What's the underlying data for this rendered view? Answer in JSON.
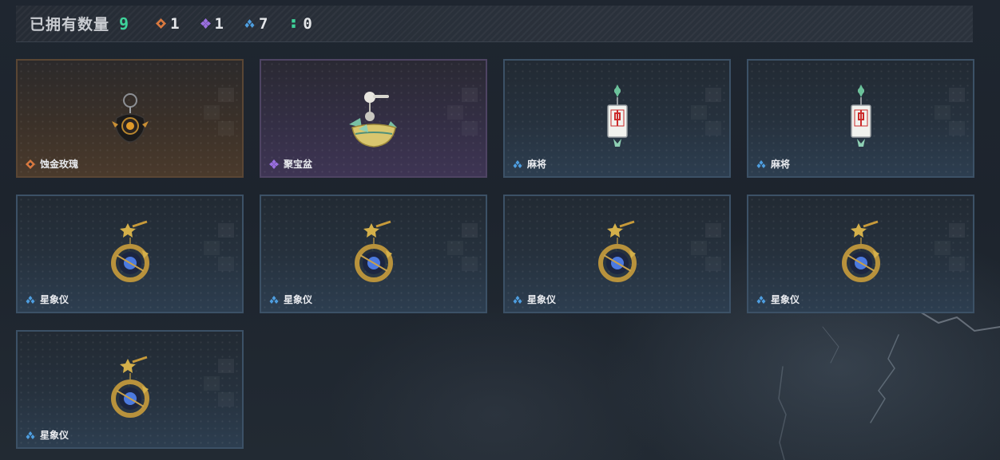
{
  "header": {
    "title": "已拥有数量",
    "total": "9",
    "counts": [
      {
        "rarity": "orange",
        "icon": "orange-gem-icon",
        "color": "#d9793f",
        "value": "1"
      },
      {
        "rarity": "purple",
        "icon": "purple-gem-icon",
        "color": "#9a6fe0",
        "value": "1"
      },
      {
        "rarity": "blue",
        "icon": "blue-gem-icon",
        "color": "#4e9ee0",
        "value": "7"
      },
      {
        "rarity": "green",
        "icon": "green-gem-icon",
        "color": "#3ed39a",
        "value": "0"
      }
    ]
  },
  "items": [
    {
      "name": "蚀金玫瑰",
      "rarity": "orange",
      "icon": "rose-pendant-icon"
    },
    {
      "name": "聚宝盆",
      "rarity": "purple",
      "icon": "treasure-bowl-pendant-icon"
    },
    {
      "name": "麻将",
      "rarity": "blue",
      "icon": "mahjong-pendant-icon"
    },
    {
      "name": "麻将",
      "rarity": "blue",
      "icon": "mahjong-pendant-icon"
    },
    {
      "name": "星象仪",
      "rarity": "blue",
      "icon": "astrolabe-pendant-icon"
    },
    {
      "name": "星象仪",
      "rarity": "blue",
      "icon": "astrolabe-pendant-icon"
    },
    {
      "name": "星象仪",
      "rarity": "blue",
      "icon": "astrolabe-pendant-icon"
    },
    {
      "name": "星象仪",
      "rarity": "blue",
      "icon": "astrolabe-pendant-icon"
    },
    {
      "name": "星象仪",
      "rarity": "blue",
      "icon": "astrolabe-pendant-icon"
    }
  ],
  "colors": {
    "accent_total": "#3ed39a",
    "orange": "#d9793f",
    "purple": "#9a6fe0",
    "blue": "#4e9ee0"
  }
}
